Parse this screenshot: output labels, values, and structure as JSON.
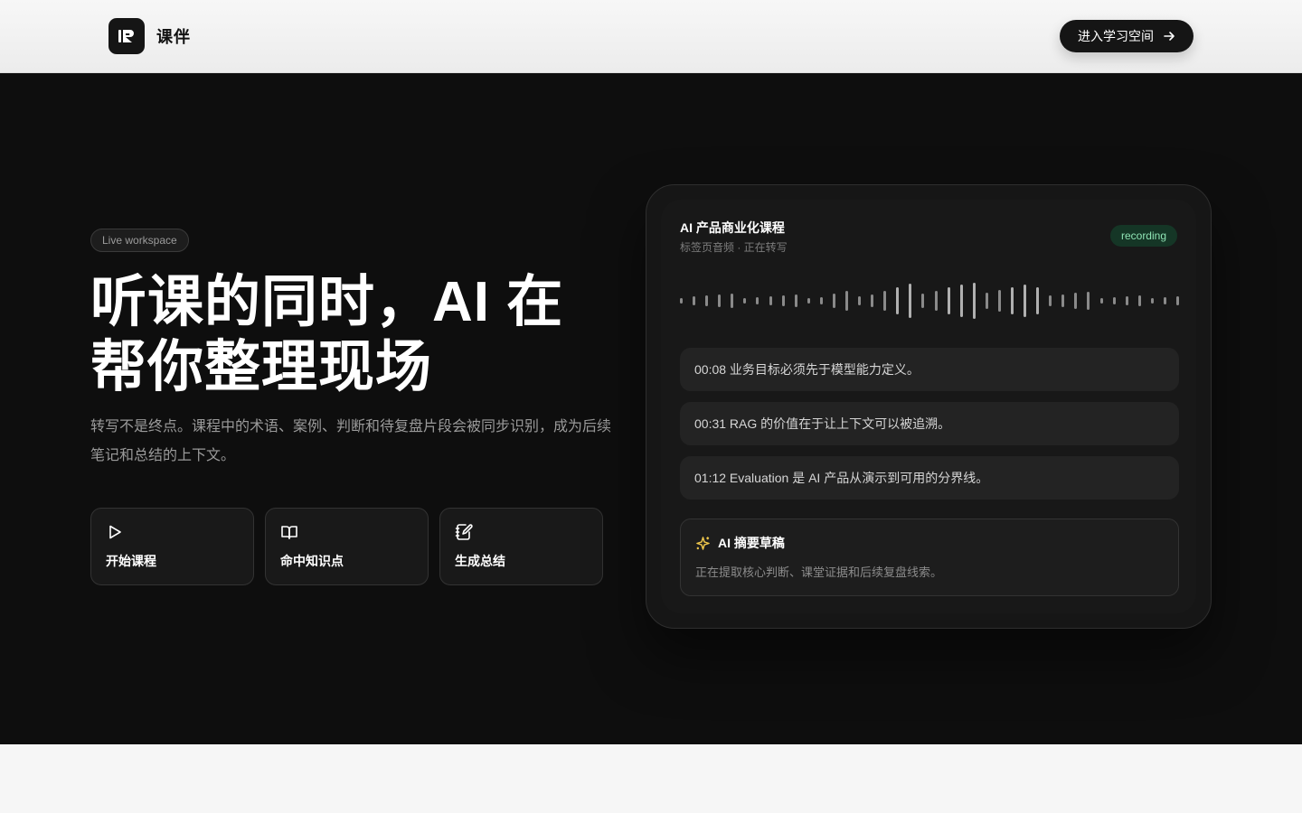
{
  "header": {
    "brand_name": "课伴",
    "enter_label": "进入学习空间",
    "logo_icon": "logo-icon",
    "arrow_icon": "arrow-right-icon"
  },
  "hero": {
    "badge": "Live workspace",
    "headline_line1": "听课的同时，AI 在",
    "headline_line2": "帮你整理现场",
    "subtitle": "转写不是终点。课程中的术语、案例、判断和待复盘片段会被同步识别，成为后续笔记和总结的上下文。",
    "actions": [
      {
        "label": "开始课程",
        "icon": "play-icon"
      },
      {
        "label": "命中知识点",
        "icon": "book-open-icon"
      },
      {
        "label": "生成总结",
        "icon": "notebook-pen-icon"
      }
    ]
  },
  "card": {
    "title": "AI 产品商业化课程",
    "subtitle": "标签页音频 · 正在转写",
    "status": "recording",
    "segments": [
      {
        "text": "00:08 业务目标必须先于模型能力定义。"
      },
      {
        "text": "00:31 RAG 的价值在于让上下文可以被追溯。"
      },
      {
        "text": "01:12 Evaluation 是 AI 产品从演示到可用的分界线。"
      }
    ],
    "summary_title": "AI 摘要草稿",
    "summary_text": "正在提取核心判断、课堂证据和后续复盘线索。",
    "summary_icon": "sparkles-icon"
  },
  "colors": {
    "accent_status_bg": "#153626",
    "accent_status_text": "#8fe3b4",
    "hero_bg": "#0e0e0e"
  }
}
